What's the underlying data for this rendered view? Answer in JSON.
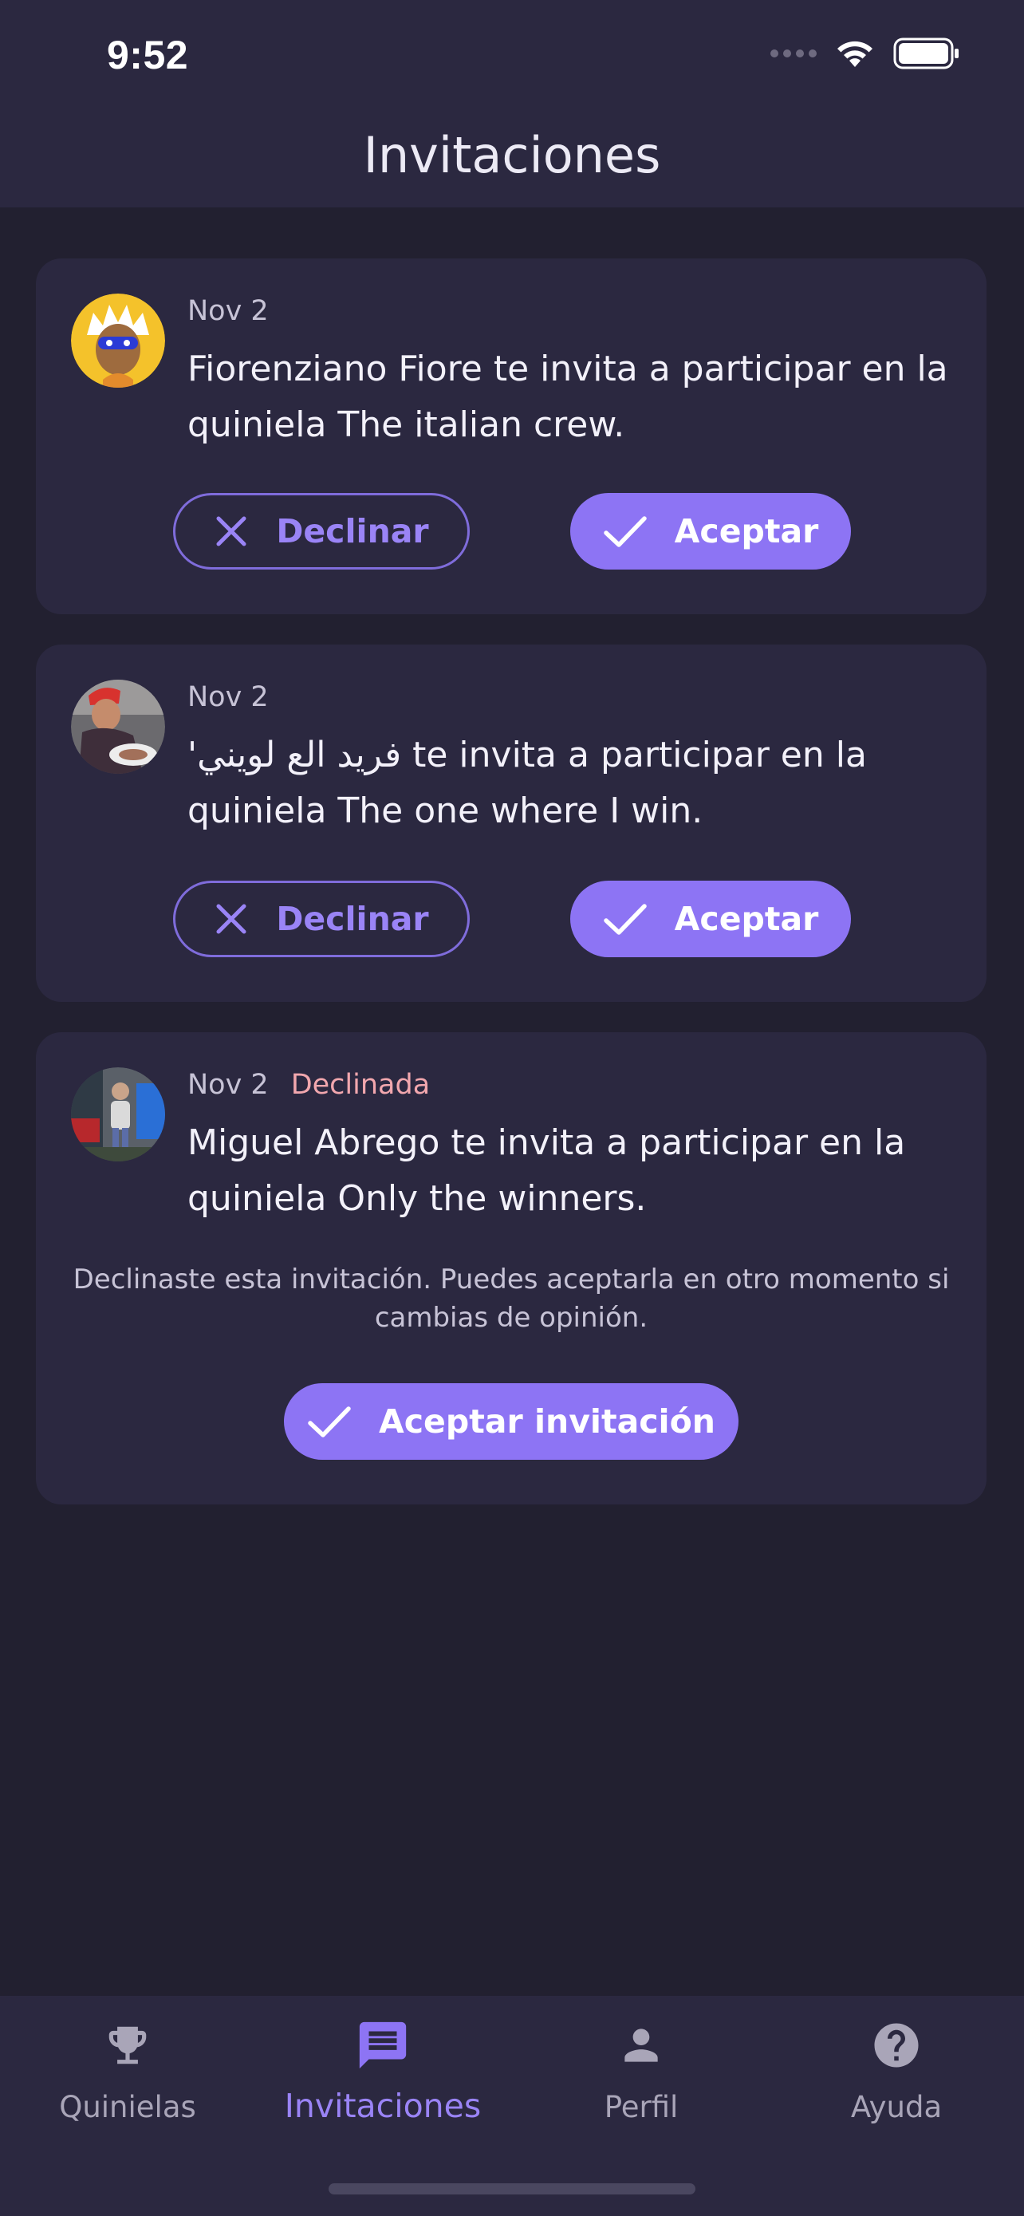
{
  "status_bar": {
    "time": "9:52"
  },
  "header": {
    "title": "Invitaciones"
  },
  "invitations": [
    {
      "date": "Nov 2",
      "message": "Fiorenziano Fiore te invita a participar en la quiniela The italian crew.",
      "decline_label": "Declinar",
      "accept_label": "Aceptar"
    },
    {
      "date": "Nov 2",
      "message": "'فريد الع لويني te invita a participar en la quiniela The one where I win.",
      "decline_label": "Declinar",
      "accept_label": "Aceptar"
    },
    {
      "date": "Nov 2",
      "status": "Declinada",
      "message": "Miguel Abrego te invita a participar en la quiniela Only the winners.",
      "note": "Declinaste esta invitación. Puedes aceptarla en otro momento si cambias de opinión.",
      "accept_label": "Aceptar invitación"
    }
  ],
  "bottom_nav": {
    "items": [
      {
        "label": "Quinielas",
        "icon": "trophy-icon"
      },
      {
        "label": "Invitaciones",
        "icon": "message-icon",
        "active": true
      },
      {
        "label": "Perfil",
        "icon": "person-icon"
      },
      {
        "label": "Ayuda",
        "icon": "help-icon"
      }
    ]
  },
  "colors": {
    "background": "#222030",
    "surface": "#2B2840",
    "accent": "#8D74F4",
    "declined": "#F2A7AE"
  }
}
